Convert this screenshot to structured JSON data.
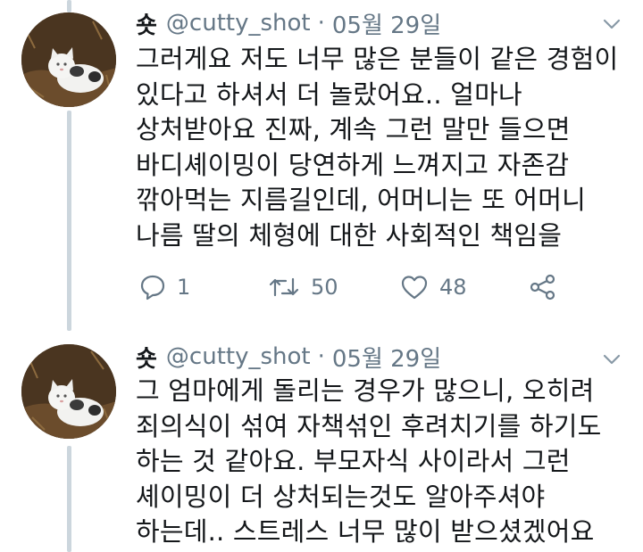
{
  "colors": {
    "text": "#14171a",
    "secondary": "#657786",
    "thread_line": "#ccd6dd"
  },
  "tweets": [
    {
      "avatar_icon": "cat-avatar-icon",
      "name": "숏",
      "handle": "@cutty_shot",
      "separator": "·",
      "date": "05월 29일",
      "lines": [
        "그러게요 저도 너무 많은 분들이 같은 경험이",
        "있다고 하셔서 더 놀랐어요.. 얼마나",
        "상처받아요 진짜, 계속 그런 말만 들으면",
        "바디셰이밍이 당연하게 느껴지고 자존감",
        "깎아먹는 지름길인데, 어머니는 또 어머니",
        "나름 딸의 체형에 대한 사회적인 책임을"
      ],
      "reply_count": "1",
      "retweet_count": "50",
      "like_count": "48"
    },
    {
      "avatar_icon": "cat-avatar-icon",
      "name": "숏",
      "handle": "@cutty_shot",
      "separator": "·",
      "date": "05월 29일",
      "lines": [
        "그 엄마에게 돌리는 경우가 많으니, 오히려",
        "죄의식이 섞여 자책섞인 후려치기를 하기도",
        "하는 것 같아요. 부모자식 사이라서 그런",
        "셰이밍이 더 상처되는것도 알아주셔야",
        "하는데.. 스트레스 너무 많이 받으셨겠어요"
      ]
    }
  ]
}
